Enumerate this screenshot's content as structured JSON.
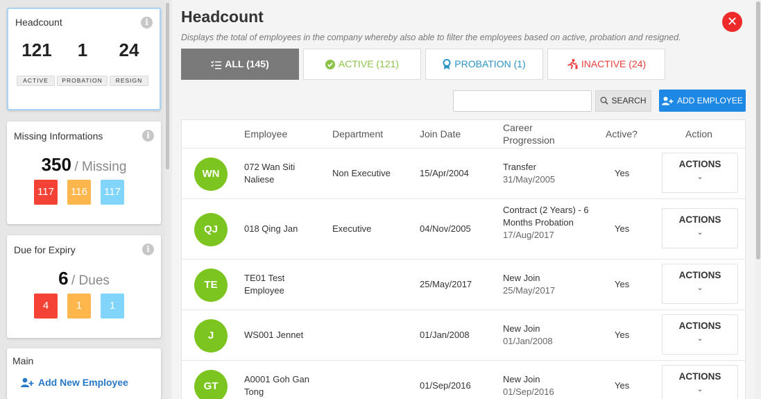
{
  "sidebar": {
    "headcount": {
      "title": "Headcount",
      "active": "121",
      "probation": "1",
      "resign": "24",
      "active_label": "ACTIVE",
      "probation_label": "PROBATION",
      "resign_label": "RESIGN"
    },
    "missing": {
      "title": "Missing Informations",
      "total": "350",
      "sep": "/ Missing",
      "values": [
        "117",
        "116",
        "117"
      ]
    },
    "expiry": {
      "title": "Due for Expiry",
      "total": "6",
      "sep": "/ Dues",
      "values": [
        "4",
        "1",
        "1"
      ]
    },
    "main": {
      "title": "Main",
      "add_new_employee": "Add New Employee"
    }
  },
  "header": {
    "title": "Headcount",
    "subtitle": "Displays the total of employees in the company whereby also able to filter the employees based on active, probation and resigned."
  },
  "tabs": {
    "all": "ALL (145)",
    "active": "ACTIVE (121)",
    "probation": "PROBATION (1)",
    "inactive": "INACTIVE (24)"
  },
  "search": {
    "placeholder": "",
    "button": "SEARCH"
  },
  "add_employee": "ADD EMPLOYEE",
  "table": {
    "columns": [
      "Employee",
      "Department",
      "Join Date",
      "Career Progression",
      "Active?",
      "Action"
    ],
    "rows": [
      {
        "initials": "WN",
        "employee": "072 Wan Siti Naliese",
        "department": "Non Executive",
        "join_date": "15/Apr/2004",
        "career": "Transfer",
        "career_date": "31/May/2005",
        "active": "Yes",
        "action": "ACTIONS"
      },
      {
        "initials": "QJ",
        "employee": "018 Qing Jan",
        "department": "Executive",
        "join_date": "04/Nov/2005",
        "career": "Contract (2 Years) - 6 Months Probation",
        "career_date": "17/Aug/2017",
        "active": "Yes",
        "action": "ACTIONS"
      },
      {
        "initials": "TE",
        "employee": "TE01 Test Employee",
        "department": "",
        "join_date": "25/May/2017",
        "career": "New Join",
        "career_date": "25/May/2017",
        "active": "Yes",
        "action": "ACTIONS"
      },
      {
        "initials": "J",
        "employee": "WS001 Jennet",
        "department": "",
        "join_date": "01/Jan/2008",
        "career": "New Join",
        "career_date": "01/Jan/2008",
        "active": "Yes",
        "action": "ACTIONS"
      },
      {
        "initials": "GT",
        "employee": "A0001 Goh Gan Tong",
        "department": "",
        "join_date": "01/Sep/2016",
        "career": "New Join",
        "career_date": "01/Sep/2016",
        "active": "Yes",
        "action": "ACTIONS"
      }
    ]
  },
  "colors": {
    "avatar_green": "#7cc520",
    "primary_blue": "#1e88e5",
    "active_green": "#8bc34a",
    "probation_blue": "#2a94c4",
    "inactive_red": "#ee3d3d",
    "close_red": "#ee2a2a"
  },
  "icons": {
    "info": "info-icon",
    "close": "close-icon",
    "all": "list-check-icon",
    "active": "check-circle-icon",
    "probation": "badge-icon",
    "inactive": "exit-icon",
    "search": "search-icon",
    "add_employee": "user-plus-icon",
    "chevron": "chevron-down-icon"
  }
}
